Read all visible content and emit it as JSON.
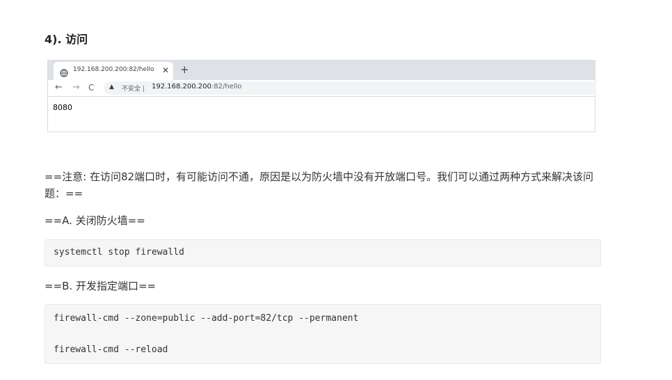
{
  "heading": "4). 访问",
  "browser": {
    "tab_title": "192.168.200.200:82/hello",
    "tab_close": "✕",
    "new_tab": "+",
    "back": "←",
    "forward": "→",
    "reload": "C",
    "warning_icon": "▲",
    "insecure_label": "不安全 |",
    "url_host": "192.168.200.200",
    "url_path": ":82/hello",
    "page_content": "8080"
  },
  "note": "==注意: 在访问82端口时，有可能访问不通，原因是以为防火墙中没有开放端口号。我们可以通过两种方式来解决该问题：==",
  "option_a": "==A. 关闭防火墙==",
  "code_a": [
    "systemctl stop firewalld"
  ],
  "option_b": "==B. 开发指定端口==",
  "code_b": [
    "firewall-cmd --zone=public --add-port=82/tcp --permanent",
    "firewall-cmd --reload"
  ]
}
